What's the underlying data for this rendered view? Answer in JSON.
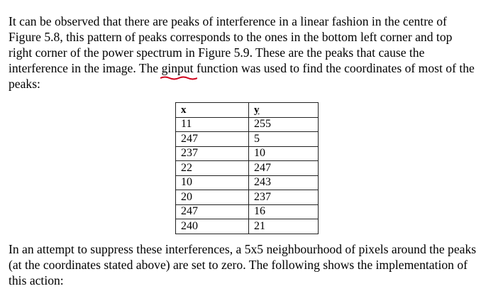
{
  "paragraph1": {
    "line1": "It can be observed that there are peaks of interference in a linear fashion in the centre of",
    "line2": "Figure 5.8, this pattern of peaks corresponds to the ones in the bottom left corner and top",
    "line3": "right corner of the power spectrum in Figure 5.9. These are the peaks that cause the",
    "line4_before": "interference in the image. The ",
    "line4_word": "ginput",
    "line4_after": " function was used to find the coordinates of most of the",
    "line5": "peaks:"
  },
  "table": {
    "headers": [
      "x",
      "y"
    ],
    "rows": [
      [
        "11",
        "255"
      ],
      [
        "247",
        "5"
      ],
      [
        "237",
        "10"
      ],
      [
        "22",
        "247"
      ],
      [
        "10",
        "243"
      ],
      [
        "20",
        "237"
      ],
      [
        "247",
        "16"
      ],
      [
        "240",
        "21"
      ]
    ]
  },
  "paragraph2": {
    "line1": "In an attempt to suppress these interferences, a 5x5 neighbourhood of pixels around the peaks",
    "line2": "(at the coordinates stated above) are set to zero. The following shows the implementation of",
    "line3": "this action:"
  },
  "colors": {
    "spellcheck_underline": "#d0021b"
  }
}
